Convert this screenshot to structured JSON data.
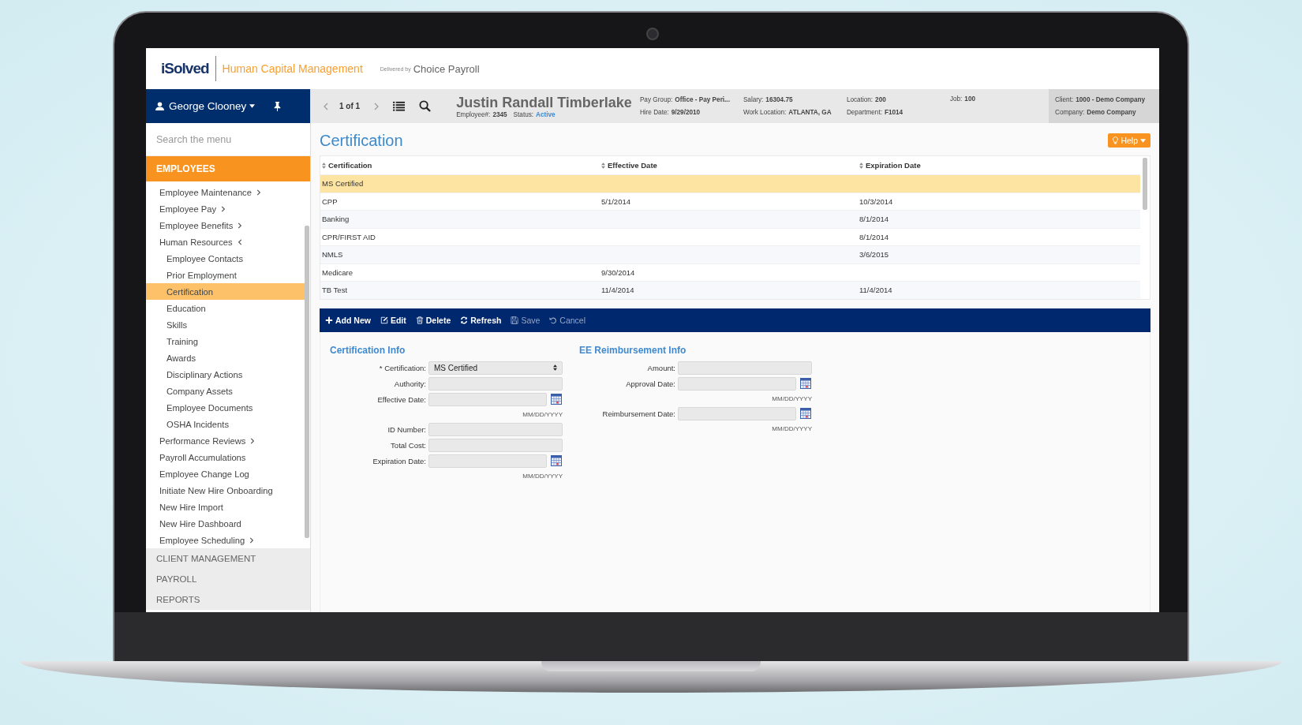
{
  "header": {
    "logo": "iSolved",
    "product": "Human Capital Management",
    "delivered_by": "Delivered by",
    "partner": "Choice Payroll"
  },
  "user": {
    "name": "George Clooney"
  },
  "navigator": {
    "position": "1 of 1"
  },
  "employee": {
    "name": "Justin Randall Timberlake",
    "number_label": "Employee#:",
    "number": "2345",
    "status_label": "Status:",
    "status": "Active"
  },
  "info_columns": [
    [
      {
        "label": "Pay Group:",
        "value": "Office - Pay Peri..."
      },
      {
        "label": "Hire Date:",
        "value": "9/29/2010"
      }
    ],
    [
      {
        "label": "Salary:",
        "value": "16304.75"
      },
      {
        "label": "Work Location:",
        "value": "ATLANTA, GA"
      }
    ],
    [
      {
        "label": "Location:",
        "value": "200"
      },
      {
        "label": "Department:",
        "value": "F1014"
      }
    ],
    [
      {
        "label": "Job:",
        "value": "100"
      }
    ]
  ],
  "client_info": [
    {
      "label": "Client:",
      "value": "1000 - Demo Company"
    },
    {
      "label": "Company:",
      "value": "Demo Company"
    }
  ],
  "sidebar": {
    "search_placeholder": "Search the menu",
    "section": "EMPLOYEES",
    "items": [
      {
        "label": "Employee Maintenance",
        "kind": "group",
        "expanded": false,
        "selected": false
      },
      {
        "label": "Employee Pay",
        "kind": "group",
        "expanded": false,
        "selected": false
      },
      {
        "label": "Employee Benefits",
        "kind": "group",
        "expanded": false,
        "selected": false
      },
      {
        "label": "Human Resources",
        "kind": "group",
        "expanded": true,
        "selected": false,
        "children": [
          {
            "label": "Employee Contacts",
            "selected": false
          },
          {
            "label": "Prior Employment",
            "selected": false
          },
          {
            "label": "Certification",
            "selected": true
          },
          {
            "label": "Education",
            "selected": false
          },
          {
            "label": "Skills",
            "selected": false
          },
          {
            "label": "Training",
            "selected": false
          },
          {
            "label": "Awards",
            "selected": false
          },
          {
            "label": "Disciplinary Actions",
            "selected": false
          },
          {
            "label": "Company Assets",
            "selected": false
          },
          {
            "label": "Employee Documents",
            "selected": false
          },
          {
            "label": "OSHA Incidents",
            "selected": false
          }
        ]
      },
      {
        "label": "Performance Reviews",
        "kind": "group",
        "expanded": false,
        "selected": false
      },
      {
        "label": "Payroll Accumulations",
        "kind": "link",
        "selected": false
      },
      {
        "label": "Employee Change Log",
        "kind": "link",
        "selected": false
      },
      {
        "label": "Initiate New Hire Onboarding",
        "kind": "link",
        "selected": false
      },
      {
        "label": "New Hire Import",
        "kind": "link",
        "selected": false
      },
      {
        "label": "New Hire Dashboard",
        "kind": "link",
        "selected": false
      },
      {
        "label": "Employee Scheduling",
        "kind": "group",
        "expanded": false,
        "selected": false
      }
    ],
    "other_sections": [
      "CLIENT MANAGEMENT",
      "PAYROLL",
      "REPORTS"
    ]
  },
  "page_title": "Certification",
  "help_button": "Help",
  "table": {
    "columns": [
      "Certification",
      "Effective Date",
      "Expiration Date"
    ],
    "rows": [
      {
        "certification": "MS Certified",
        "selected": true
      },
      {
        "certification": "CPP",
        "effective_date": "5/1/2014",
        "expiration_date": "10/3/2014",
        "selected": false
      },
      {
        "certification": "Banking",
        "expiration_date": "8/1/2014",
        "selected": false
      },
      {
        "certification": "CPR/FIRST AID",
        "expiration_date": "8/1/2014",
        "selected": false
      },
      {
        "certification": "NMLS",
        "expiration_date": "3/6/2015",
        "selected": false
      },
      {
        "certification": "Medicare",
        "effective_date": "9/30/2014",
        "selected": false
      },
      {
        "certification": "TB Test",
        "effective_date": "11/4/2014",
        "expiration_date": "11/4/2014",
        "selected": false
      }
    ]
  },
  "toolbar": {
    "buttons": [
      {
        "label": "Add New",
        "kind": "add",
        "disabled": false
      },
      {
        "label": "Edit",
        "kind": "edit",
        "disabled": false
      },
      {
        "label": "Delete",
        "kind": "delete",
        "disabled": false
      },
      {
        "label": "Refresh",
        "kind": "refresh",
        "disabled": false
      },
      {
        "label": "Save",
        "kind": "save",
        "disabled": true
      },
      {
        "label": "Cancel",
        "kind": "cancel",
        "disabled": true
      }
    ]
  },
  "form_sections": [
    {
      "title": "Certification Info",
      "fields": [
        {
          "label": "* Certification:",
          "kind": "select",
          "value": "MS Certified"
        },
        {
          "label": "Authority:",
          "kind": "text"
        },
        {
          "label": "Effective Date:",
          "kind": "date",
          "hint": "MM/DD/YYYY"
        },
        {
          "label": "ID Number:",
          "kind": "text"
        },
        {
          "label": "Total Cost:",
          "kind": "text"
        },
        {
          "label": "Expiration Date:",
          "kind": "date",
          "hint": "MM/DD/YYYY"
        }
      ]
    },
    {
      "title": "EE Reimbursement Info",
      "fields": [
        {
          "label": "Amount:",
          "kind": "text"
        },
        {
          "label": "Approval Date:",
          "kind": "date",
          "hint": "MM/DD/YYYY"
        },
        {
          "label": "Reimbursement Date:",
          "kind": "date",
          "hint": "MM/DD/YYYY"
        }
      ]
    }
  ]
}
